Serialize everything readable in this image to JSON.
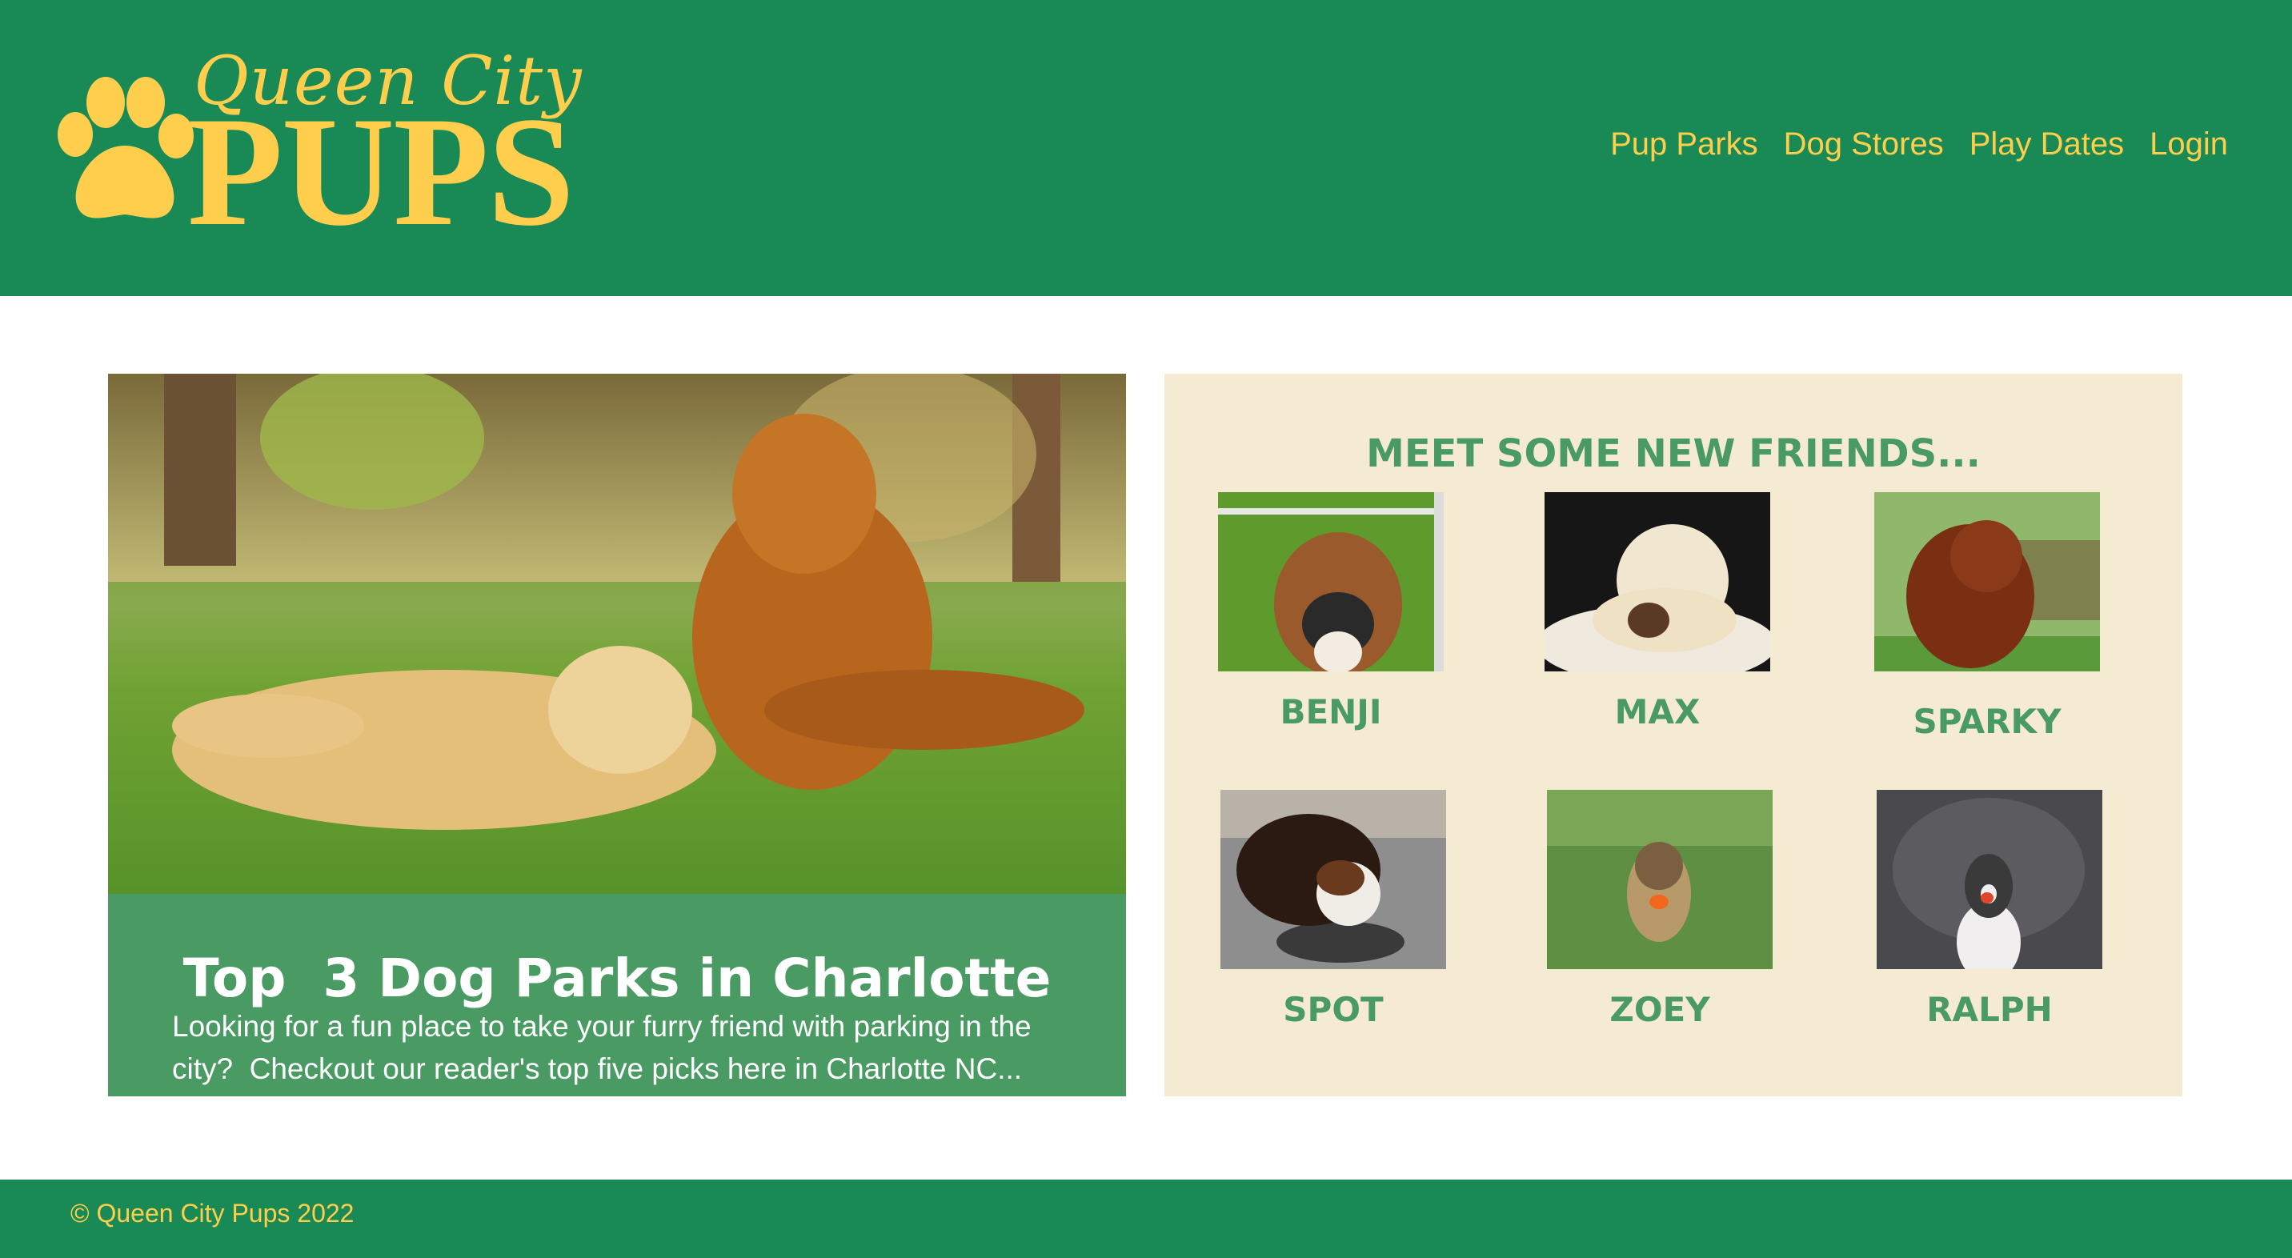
{
  "colors": {
    "header_bg": "#198a55",
    "accent_yellow": "#fece4c",
    "card_green": "#4a9b63",
    "panel_cream": "#f5ead2"
  },
  "header": {
    "logo_script": "Queen City",
    "logo_word": "PUPS",
    "logo_icon": "paw-icon",
    "nav": [
      {
        "label": "Pup Parks"
      },
      {
        "label": "Dog Stores"
      },
      {
        "label": "Play Dates"
      },
      {
        "label": "Login"
      }
    ]
  },
  "feature": {
    "title": "Top  3 Dog Parks in Charlotte",
    "text": "Looking for a fun place to take your furry friend with parking in the city?  Checkout our reader's top five picks here in Charlotte NC..."
  },
  "friends": {
    "heading": "MEET SOME NEW FRIENDS...",
    "dogs": [
      {
        "name": "BENJI"
      },
      {
        "name": "MAX"
      },
      {
        "name": "SPARKY"
      },
      {
        "name": "SPOT"
      },
      {
        "name": "ZOEY"
      },
      {
        "name": "RALPH"
      }
    ]
  },
  "footer": {
    "copyright": "© Queen City Pups 2022"
  }
}
